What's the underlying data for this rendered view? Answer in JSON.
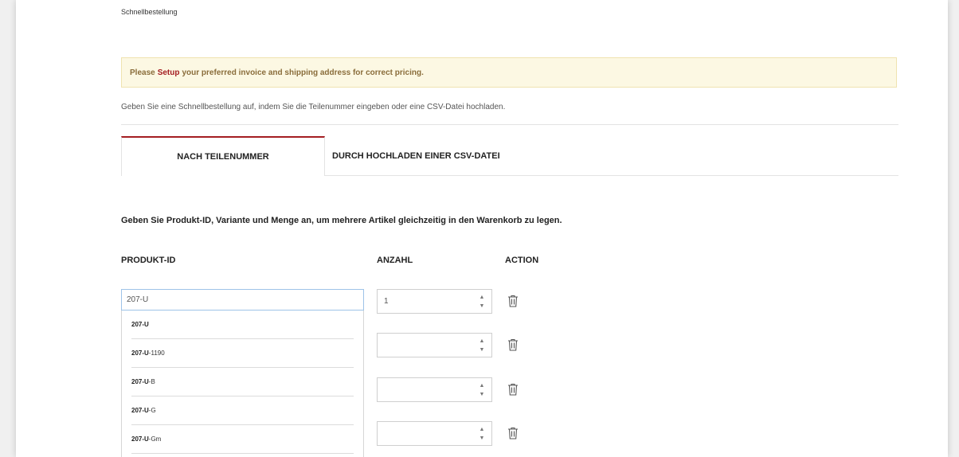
{
  "breadcrumb": "Schnellbestellung",
  "alert": {
    "prefix": "Please",
    "link": "Setup",
    "suffix": "your preferred invoice and shipping address for correct pricing."
  },
  "intro": "Geben Sie eine Schnellbestellung auf, indem Sie die Teilenummer eingeben oder eine CSV-Datei hochladen.",
  "tabs": {
    "part_number": "NACH TEILENUMMER",
    "csv_upload": "DURCH HOCHLADEN EINER CSV-DATEI"
  },
  "instruction": "Geben Sie Produkt-ID, Variante und Menge an, um mehrere Artikel gleichzeitig in den Warenkorb zu legen.",
  "columns": {
    "product_id": "PRODUKT-ID",
    "quantity": "ANZAHL",
    "action": "ACTION"
  },
  "product_input": {
    "value": "207-U"
  },
  "suggestions": [
    {
      "match": "207-U",
      "rest": ""
    },
    {
      "match": "207-U",
      "rest": "-1190"
    },
    {
      "match": "207-U",
      "rest": "-B"
    },
    {
      "match": "207-U",
      "rest": "-G"
    },
    {
      "match": "207-U",
      "rest": "-Gm"
    }
  ],
  "rows": [
    {
      "quantity": "1"
    },
    {
      "quantity": ""
    },
    {
      "quantity": ""
    },
    {
      "quantity": ""
    }
  ],
  "colors": {
    "accent": "#a41e22",
    "alert_bg": "#fcf8e3",
    "alert_text": "#8a6d3b",
    "input_focus_border": "#9ec3e8"
  },
  "icons": {
    "spinner": "up-down-spinner-icon",
    "delete": "trash-icon"
  }
}
